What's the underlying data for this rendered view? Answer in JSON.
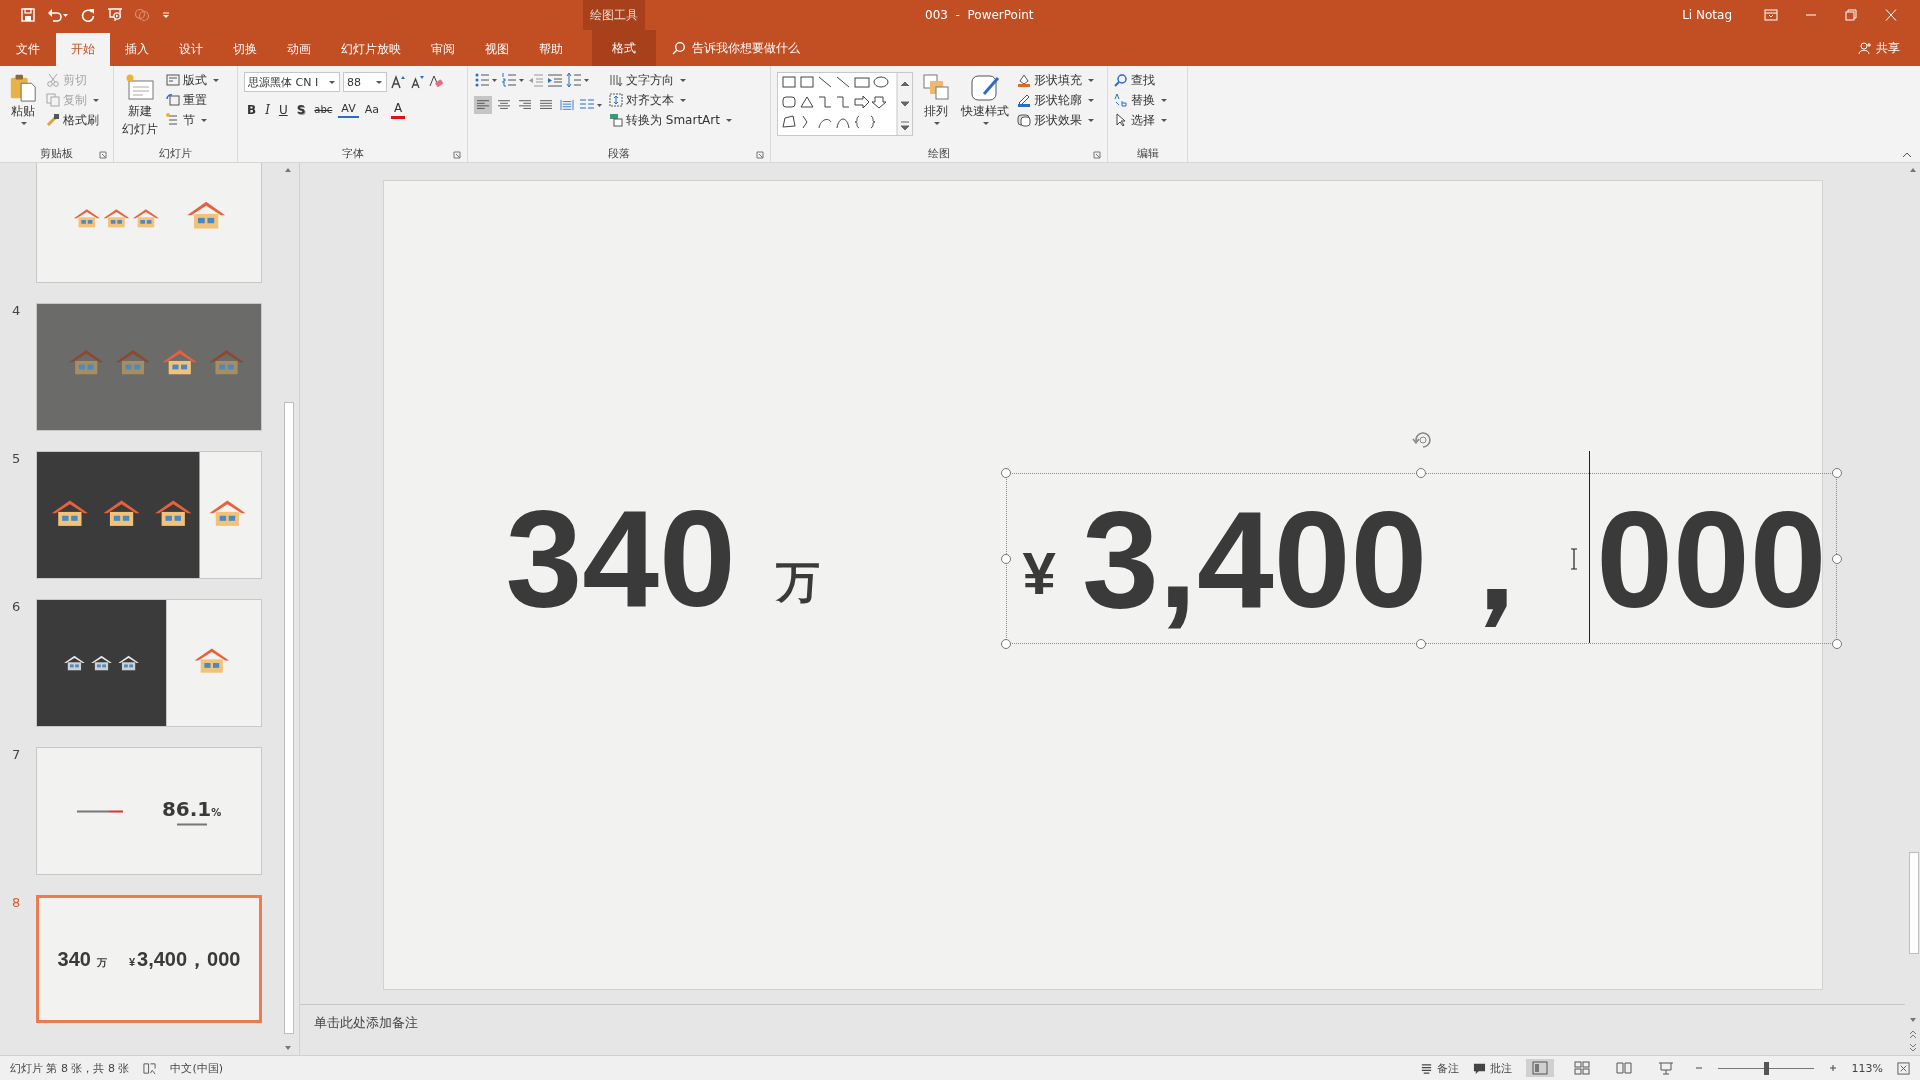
{
  "title_bar": {
    "context_label": "绘图工具",
    "title": "003  -  PowerPoint",
    "user": "Li Notag"
  },
  "tabs": [
    {
      "label": "文件",
      "selected": false,
      "kind": "file"
    },
    {
      "label": "开始",
      "selected": true,
      "kind": "normal"
    },
    {
      "label": "插入",
      "selected": false,
      "kind": "normal"
    },
    {
      "label": "设计",
      "selected": false,
      "kind": "normal"
    },
    {
      "label": "切换",
      "selected": false,
      "kind": "normal"
    },
    {
      "label": "动画",
      "selected": false,
      "kind": "normal"
    },
    {
      "label": "幻灯片放映",
      "selected": false,
      "kind": "normal"
    },
    {
      "label": "审阅",
      "selected": false,
      "kind": "normal"
    },
    {
      "label": "视图",
      "selected": false,
      "kind": "normal"
    },
    {
      "label": "帮助",
      "selected": false,
      "kind": "normal"
    },
    {
      "label": "格式",
      "selected": false,
      "kind": "context"
    }
  ],
  "tell_me": {
    "placeholder": "告诉我你想要做什么"
  },
  "share": "共享",
  "ribbon": {
    "clipboard": {
      "label": "剪贴板",
      "paste": "粘贴",
      "items": [
        {
          "label": "剪切",
          "disabled": true
        },
        {
          "label": "复制",
          "disabled": true
        },
        {
          "label": "格式刷",
          "disabled": false
        }
      ]
    },
    "slides": {
      "label": "幻灯片",
      "new_slide": [
        "新建",
        "幻灯片"
      ],
      "items": [
        "版式",
        "重置",
        "节"
      ]
    },
    "font": {
      "label": "字体",
      "font_name": "思源黑体 CN I",
      "font_size": "88",
      "style_buttons": [
        {
          "label": "B",
          "kind": "bold"
        },
        {
          "label": "I",
          "kind": "italic"
        },
        {
          "label": "U",
          "kind": "underline"
        },
        {
          "label": "S",
          "kind": "shadow"
        },
        {
          "label": "abc",
          "kind": "strike"
        },
        {
          "label": "AV",
          "kind": "spacing"
        },
        {
          "label": "Aa",
          "kind": "case"
        },
        {
          "label": "A",
          "kind": "color"
        }
      ]
    },
    "paragraph": {
      "label": "段落",
      "align_buttons": [
        {
          "kind": "left",
          "selected": true
        },
        {
          "kind": "center",
          "selected": false
        },
        {
          "kind": "right",
          "selected": false
        },
        {
          "kind": "justify",
          "selected": false
        },
        {
          "kind": "distributed",
          "selected": false
        }
      ],
      "items": [
        "文字方向",
        "对齐文本",
        "转换为 SmartArt"
      ]
    },
    "drawing": {
      "label": "绘图",
      "arrange": "排列",
      "quick_styles": "快速样式",
      "items": [
        "形状填充",
        "形状轮廓",
        "形状效果"
      ]
    },
    "editing": {
      "label": "编辑",
      "items": [
        "查找",
        "替换",
        "选择"
      ]
    }
  },
  "slides_panel": [
    {
      "kind": "houses-light",
      "selected": false
    },
    {
      "number": "4",
      "kind": "houses-grey",
      "selected": false
    },
    {
      "number": "5",
      "kind": "houses-dark-wide",
      "selected": false
    },
    {
      "number": "6",
      "kind": "houses-dark-half",
      "selected": false
    },
    {
      "number": "7",
      "kind": "percent",
      "selected": false,
      "value": "86.1",
      "unit": "%"
    },
    {
      "number": "8",
      "kind": "amount",
      "selected": true,
      "left_number": "340",
      "left_unit": "万",
      "currency": "¥",
      "amount": "3,400，000"
    }
  ],
  "slide": {
    "left_number": "340",
    "left_unit": "万",
    "currency": "¥",
    "amount_before_cursor": "3,400，",
    "amount_after_cursor": "000"
  },
  "notes": {
    "placeholder": "单击此处添加备注"
  },
  "status_bar": {
    "slide_info": "幻灯片 第 8 张，共 8 张",
    "language": "中文(中国)",
    "notes": "备注",
    "comments": "批注",
    "zoom": {
      "level": 0.52
    },
    "zoom_text": "113%"
  }
}
